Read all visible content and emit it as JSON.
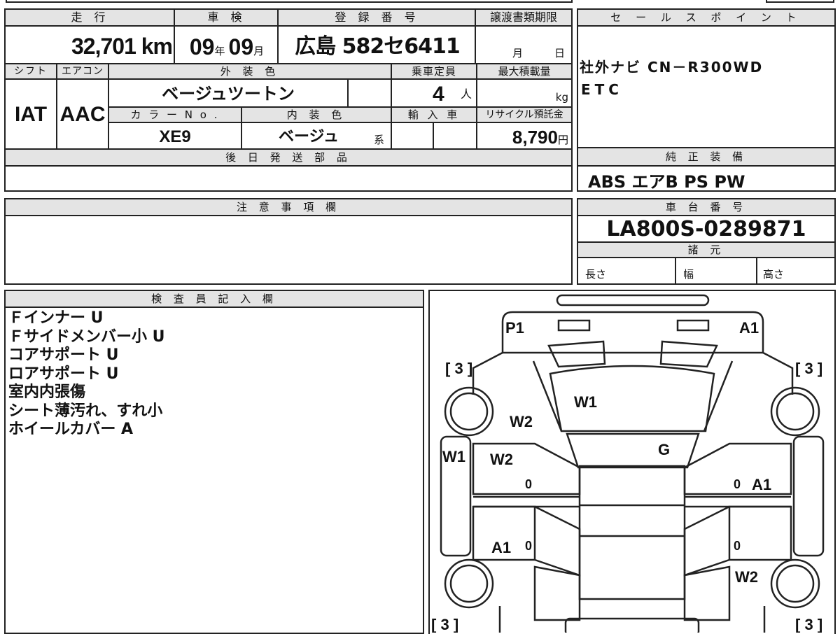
{
  "top_table": {
    "mileage_label": "走 行",
    "mileage_value": "32,701 km",
    "shaken_label": "車 検",
    "shaken_year": "09",
    "shaken_year_unit": "年",
    "shaken_month": "09",
    "shaken_month_unit": "月",
    "reg_label": "登 録 番 号",
    "reg_value": "広島 582セ6411",
    "deadline_label": "譲渡書類期限",
    "deadline_month": "月",
    "deadline_day": "日",
    "shift_label": "シフト",
    "shift_value": "IAT",
    "aircon_label": "エアコン",
    "aircon_value": "AAC",
    "ext_color_label": "外 装 色",
    "ext_color_value": "ベージュツートン",
    "capacity_label": "乗車定員",
    "capacity_value": "4",
    "capacity_unit": "人",
    "max_load_label": "最大積載量",
    "max_load_unit": "kg",
    "color_no_label": "カ ラ ー N o .",
    "color_no_value": "XE9",
    "int_color_label": "内 装 色",
    "int_color_value": "ベージュ",
    "int_color_suffix": "系",
    "import_label": "輸 入 車",
    "recycle_label": "リサイクル預託金",
    "recycle_value": "8,790",
    "recycle_unit": "円",
    "later_parts_label": "後 日 発 送 部 品"
  },
  "sales_point": {
    "label": "セ ー ル ス ポ イ ン ト",
    "lines": [
      "社外ナビ CN－R300WD",
      "ETC"
    ]
  },
  "genuine_equipment": {
    "label": "純 正 装 備",
    "value": "ABS エアB PS PW"
  },
  "caution": {
    "label": "注 意 事 項 欄"
  },
  "chassis": {
    "label": "車 台 番 号",
    "value": "LA800S-0289871",
    "specs_label": "諸 元",
    "length_label": "長さ",
    "width_label": "幅",
    "height_label": "高さ"
  },
  "inspector": {
    "label": "検 査 員 記 入 欄",
    "notes": [
      "Ｆインナー U",
      "Ｆサイドメンバー小 U",
      "コアサポート U",
      "ロアサポート U",
      "室内内張傷",
      "シート薄汚れ、すれ小",
      "ホイールカバー A"
    ]
  },
  "diagram": {
    "marks": {
      "front_left": "P1",
      "front_right": "A1",
      "hood": "W1",
      "left_front_fender": "W2",
      "windshield": "G",
      "left_pillar": "W1",
      "left_front_door": "W2",
      "right_front_door": "A1",
      "left_rear_door": "A1",
      "right_rear_fender": "W2",
      "tire_fl": "3",
      "tire_fr": "3",
      "tire_rl": "3",
      "tire_rr": "3",
      "zero": "0"
    }
  }
}
